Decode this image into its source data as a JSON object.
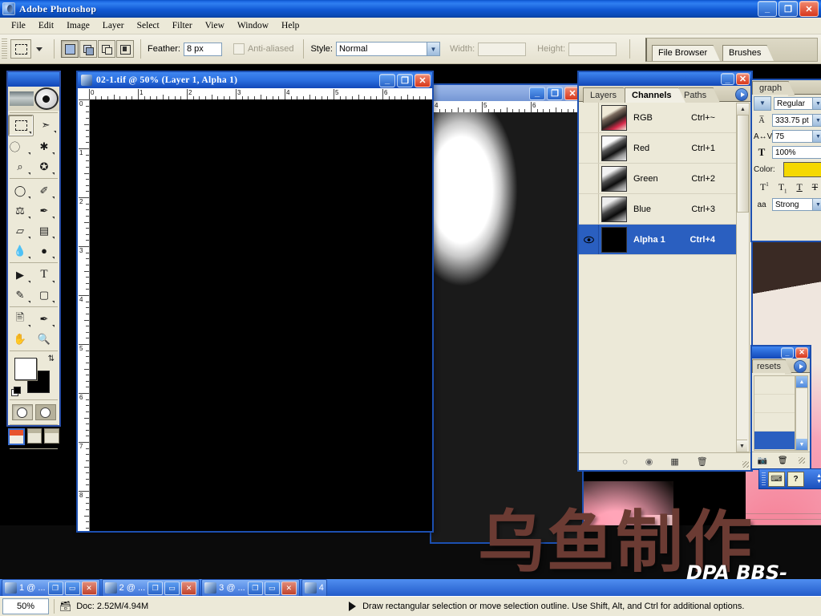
{
  "app": {
    "title": "Adobe Photoshop",
    "icon": "photoshop-icon",
    "window_controls": {
      "minimize": "_",
      "restore": "❐",
      "close": "✕"
    }
  },
  "menubar": {
    "items": [
      {
        "label": "File"
      },
      {
        "label": "Edit"
      },
      {
        "label": "Image"
      },
      {
        "label": "Layer"
      },
      {
        "label": "Select"
      },
      {
        "label": "Filter"
      },
      {
        "label": "View"
      },
      {
        "label": "Window"
      },
      {
        "label": "Help"
      }
    ]
  },
  "options_bar": {
    "tool": "rectangular-marquee",
    "selection_modes": [
      "new-selection",
      "add-to-selection",
      "subtract-from-selection",
      "intersect-with-selection"
    ],
    "active_selection_mode": 0,
    "feather_label": "Feather:",
    "feather_value": "8 px",
    "antialiased_label": "Anti-aliased",
    "antialiased_checked": false,
    "style_label": "Style:",
    "style_value": "Normal",
    "width_label": "Width:",
    "width_value": "",
    "height_label": "Height:",
    "height_value": "",
    "palette_well": [
      {
        "label": "File Browser"
      },
      {
        "label": "Brushes"
      }
    ]
  },
  "toolbox": {
    "tools": [
      {
        "name": "rectangular-marquee-tool",
        "glyph": "⬚",
        "selected": true
      },
      {
        "name": "move-tool",
        "glyph": "➤"
      },
      {
        "name": "lasso-tool",
        "glyph": "❀"
      },
      {
        "name": "magic-wand-tool",
        "glyph": "✳"
      },
      {
        "name": "crop-tool",
        "glyph": "⌗"
      },
      {
        "name": "slice-tool",
        "glyph": "✂"
      },
      {
        "name": "healing-brush-tool",
        "glyph": "✐"
      },
      {
        "name": "brush-tool",
        "glyph": "✎"
      },
      {
        "name": "clone-stamp-tool",
        "glyph": "⚙"
      },
      {
        "name": "history-brush-tool",
        "glyph": "✏"
      },
      {
        "name": "eraser-tool",
        "glyph": "▱"
      },
      {
        "name": "gradient-tool",
        "glyph": "▨"
      },
      {
        "name": "blur-tool",
        "glyph": "●"
      },
      {
        "name": "dodge-tool",
        "glyph": "⚬"
      },
      {
        "name": "path-selection-tool",
        "glyph": "➤"
      },
      {
        "name": "type-tool",
        "glyph": "T"
      },
      {
        "name": "pen-tool",
        "glyph": "✒"
      },
      {
        "name": "rectangle-tool",
        "glyph": "■"
      },
      {
        "name": "notes-tool",
        "glyph": "☰"
      },
      {
        "name": "eyedropper-tool",
        "glyph": "✒"
      },
      {
        "name": "hand-tool",
        "glyph": "✋"
      },
      {
        "name": "zoom-tool",
        "glyph": "⌕"
      }
    ],
    "foreground_color": "#ffffff",
    "background_color": "#000000",
    "mask_mode": "standard",
    "screen_mode": "standard-screen-mode",
    "jump_to": "ImageReady"
  },
  "active_document": {
    "title": "02-1.tif @ 50% (Layer 1, Alpha 1)",
    "filename": "02-1.tif",
    "zoom": "50%",
    "layer": "Layer 1",
    "channel": "Alpha 1",
    "ruler_h_labels": [
      "0",
      "1",
      "2",
      "3",
      "4",
      "5",
      "6"
    ],
    "ruler_v_labels": [
      "0",
      "1",
      "2",
      "3",
      "4",
      "5",
      "6",
      "7",
      "8"
    ],
    "canvas_color": "#000000"
  },
  "background_document": {
    "ruler_h_labels": [
      "4",
      "5",
      "6"
    ]
  },
  "channels_palette": {
    "tabs": [
      {
        "label": "Layers",
        "active": false
      },
      {
        "label": "Channels",
        "active": true
      },
      {
        "label": "Paths",
        "active": false
      }
    ],
    "rows": [
      {
        "name": "RGB",
        "shortcut": "Ctrl+~",
        "visible": false,
        "selected": false,
        "thumb": "color"
      },
      {
        "name": "Red",
        "shortcut": "Ctrl+1",
        "visible": false,
        "selected": false,
        "thumb": "gray"
      },
      {
        "name": "Green",
        "shortcut": "Ctrl+2",
        "visible": false,
        "selected": false,
        "thumb": "gray"
      },
      {
        "name": "Blue",
        "shortcut": "Ctrl+3",
        "visible": false,
        "selected": false,
        "thumb": "gray"
      },
      {
        "name": "Alpha 1",
        "shortcut": "Ctrl+4",
        "visible": true,
        "selected": true,
        "thumb": "black"
      }
    ],
    "footer_buttons": [
      {
        "name": "load-channel-as-selection-icon",
        "glyph": "◌"
      },
      {
        "name": "save-selection-as-channel-icon",
        "glyph": "◯"
      },
      {
        "name": "create-new-channel-icon",
        "glyph": "❐"
      },
      {
        "name": "delete-channel-icon",
        "glyph": "Ὕ1"
      }
    ],
    "selection_highlight_color": "#2a5fc0"
  },
  "character_palette": {
    "tab_label": "graph",
    "font_style": "Regular",
    "leading_value": "333.75 pt",
    "tracking_value": "75",
    "vertical_scale_value": "100%",
    "color_label": "Color:",
    "color_value": "#f5d800",
    "style_buttons": [
      "superscript",
      "subscript",
      "underline",
      "strikethrough"
    ],
    "antialias_label": "aa",
    "antialias_value": "Strong"
  },
  "presets_palette": {
    "tab_label": "resets"
  },
  "ime_bar": {
    "buttons": [
      "keyboard-icon",
      "help-icon"
    ]
  },
  "taskbar": {
    "windows": [
      {
        "label": "1 @ ..."
      },
      {
        "label": "2 @ ..."
      },
      {
        "label": "3 @ ..."
      },
      {
        "label": "4"
      }
    ],
    "controls": {
      "restore": "❐",
      "maximize": "▭",
      "close": "✕"
    }
  },
  "status_bar": {
    "zoom": "50%",
    "doc_label": "Doc: 2.52M/4.94M",
    "hint": "Draw rectangular selection or move selection outline. Use Shift, Alt, and Ctrl for additional options."
  },
  "watermarks": {
    "chinese": "乌鱼制作",
    "latin": "DPA BBS-EPI"
  }
}
